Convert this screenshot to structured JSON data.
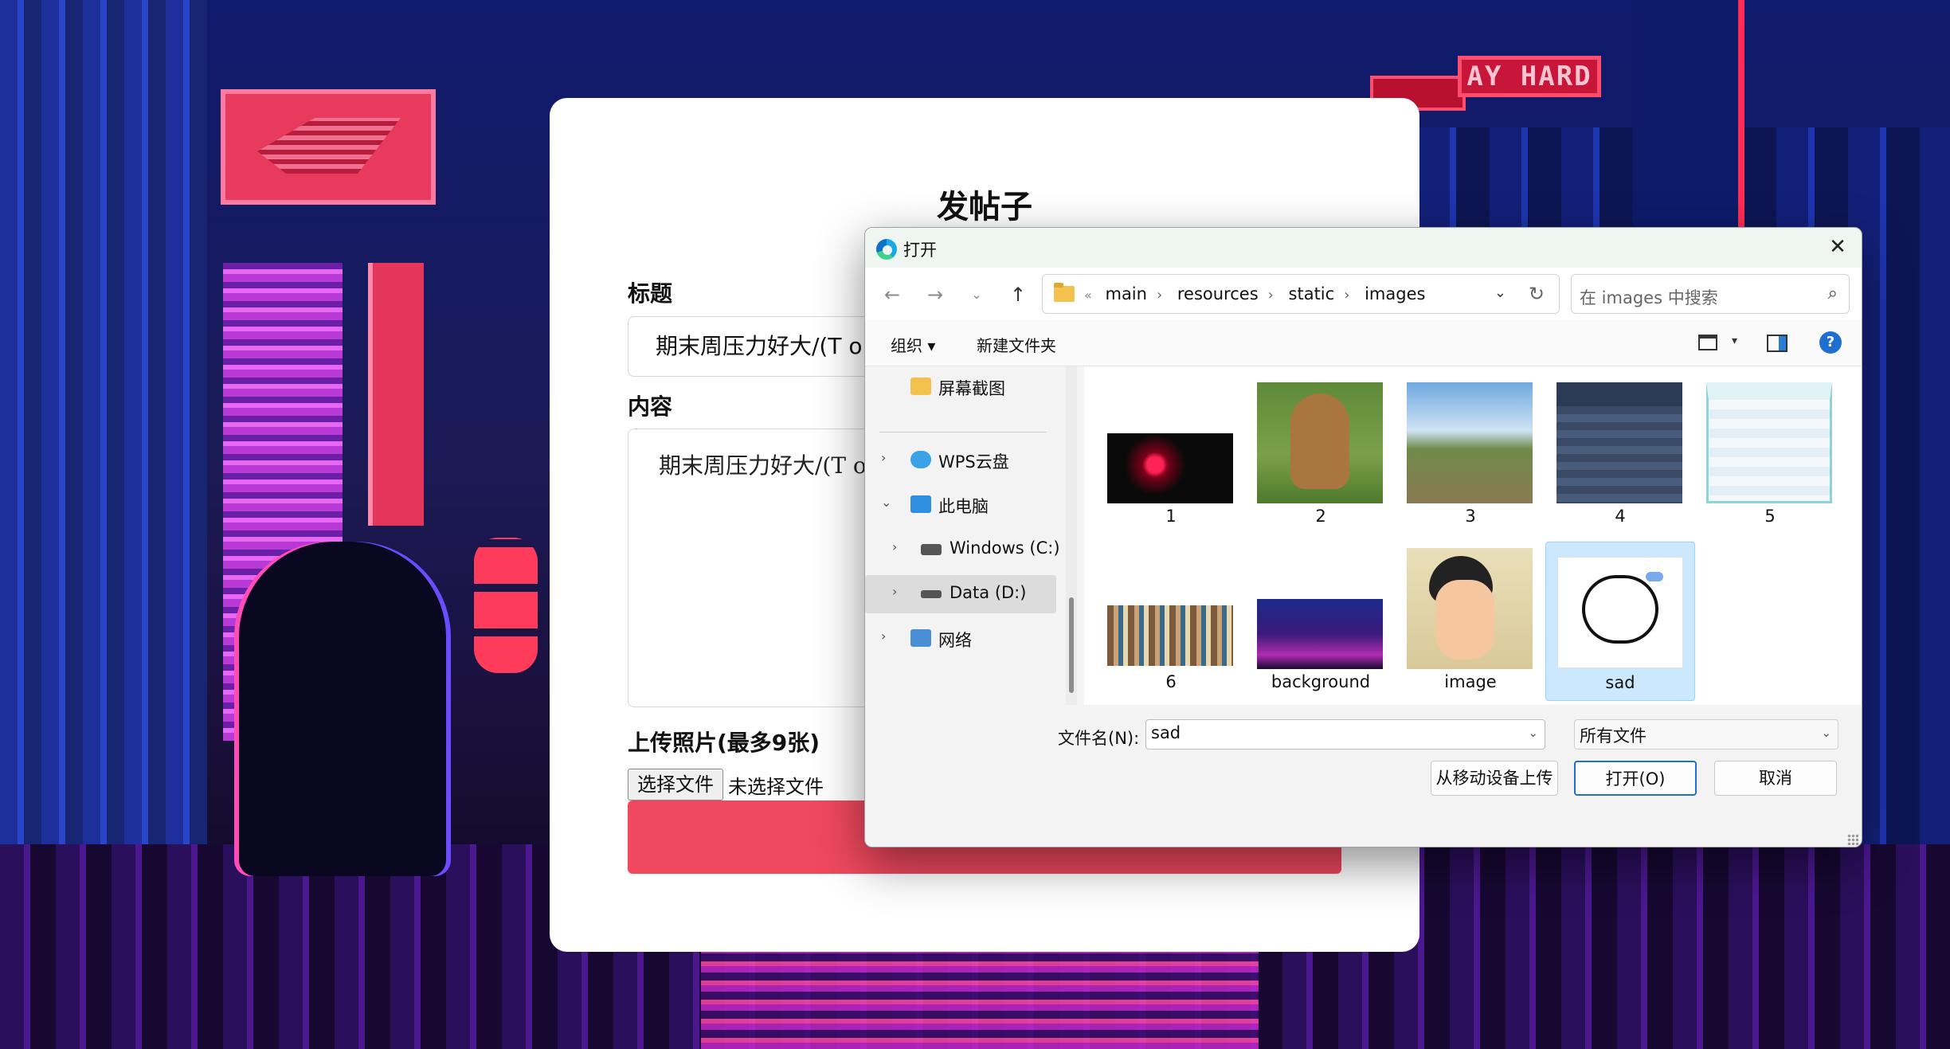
{
  "background": {
    "sign_text": "AY HARD",
    "accent_colors": [
      "#e83a5c",
      "#1e35b0",
      "#c226c9"
    ]
  },
  "form": {
    "title": "发帖子",
    "title_label": "标题",
    "title_value": "期末周压力好大/(T o T)/~~",
    "content_label": "内容",
    "content_value": "期末周压力好大/(T o T)/~~",
    "upload_label": "上传照片(最多9张)",
    "choose_file_button": "选择文件",
    "no_file_text": "未选择文件",
    "submit_color": "#f0485e"
  },
  "dialog": {
    "title": "打开",
    "app_icon": "edge-icon",
    "breadcrumb": {
      "overflow": "«",
      "items": [
        "main",
        "resources",
        "static",
        "images"
      ]
    },
    "search_placeholder": "在 images 中搜索",
    "commands": {
      "organize": "组织 ▾",
      "new_folder": "新建文件夹"
    },
    "sidebar": [
      {
        "label": "屏幕截图",
        "icon": "folder-icon",
        "expandable": false
      },
      {
        "label": "WPS云盘",
        "icon": "cloud-icon",
        "expandable": true,
        "state": "collapsed"
      },
      {
        "label": "此电脑",
        "icon": "computer-icon",
        "expandable": true,
        "state": "expanded"
      },
      {
        "label": "Windows (C:)",
        "icon": "drive-icon",
        "expandable": true,
        "state": "collapsed"
      },
      {
        "label": "Data (D:)",
        "icon": "drive-icon",
        "expandable": true,
        "state": "collapsed",
        "selected": true
      },
      {
        "label": "网络",
        "icon": "network-icon",
        "expandable": true,
        "state": "collapsed"
      }
    ],
    "files": [
      {
        "name": "1",
        "icon": "dark-red-glow-thumbnail"
      },
      {
        "name": "2",
        "icon": "cartoon-bear-thumbnail"
      },
      {
        "name": "3",
        "icon": "mountain-landscape-thumbnail"
      },
      {
        "name": "4",
        "icon": "university-ranking-table-thumbnail"
      },
      {
        "name": "5",
        "icon": "ranking-list-thumbnail"
      },
      {
        "name": "6",
        "icon": "bookshelf-thumbnail"
      },
      {
        "name": "background",
        "icon": "pixel-city-thumbnail"
      },
      {
        "name": "image",
        "icon": "cartoon-boy-thumbnail"
      },
      {
        "name": "sad",
        "icon": "sad-cloud-sticker-thumbnail",
        "selected": true
      }
    ],
    "filename_label": "文件名(N):",
    "filename_value": "sad",
    "filetype_value": "所有文件",
    "buttons": {
      "upload_mobile": "从移动设备上传",
      "open": "打开(O)",
      "cancel": "取消"
    }
  }
}
